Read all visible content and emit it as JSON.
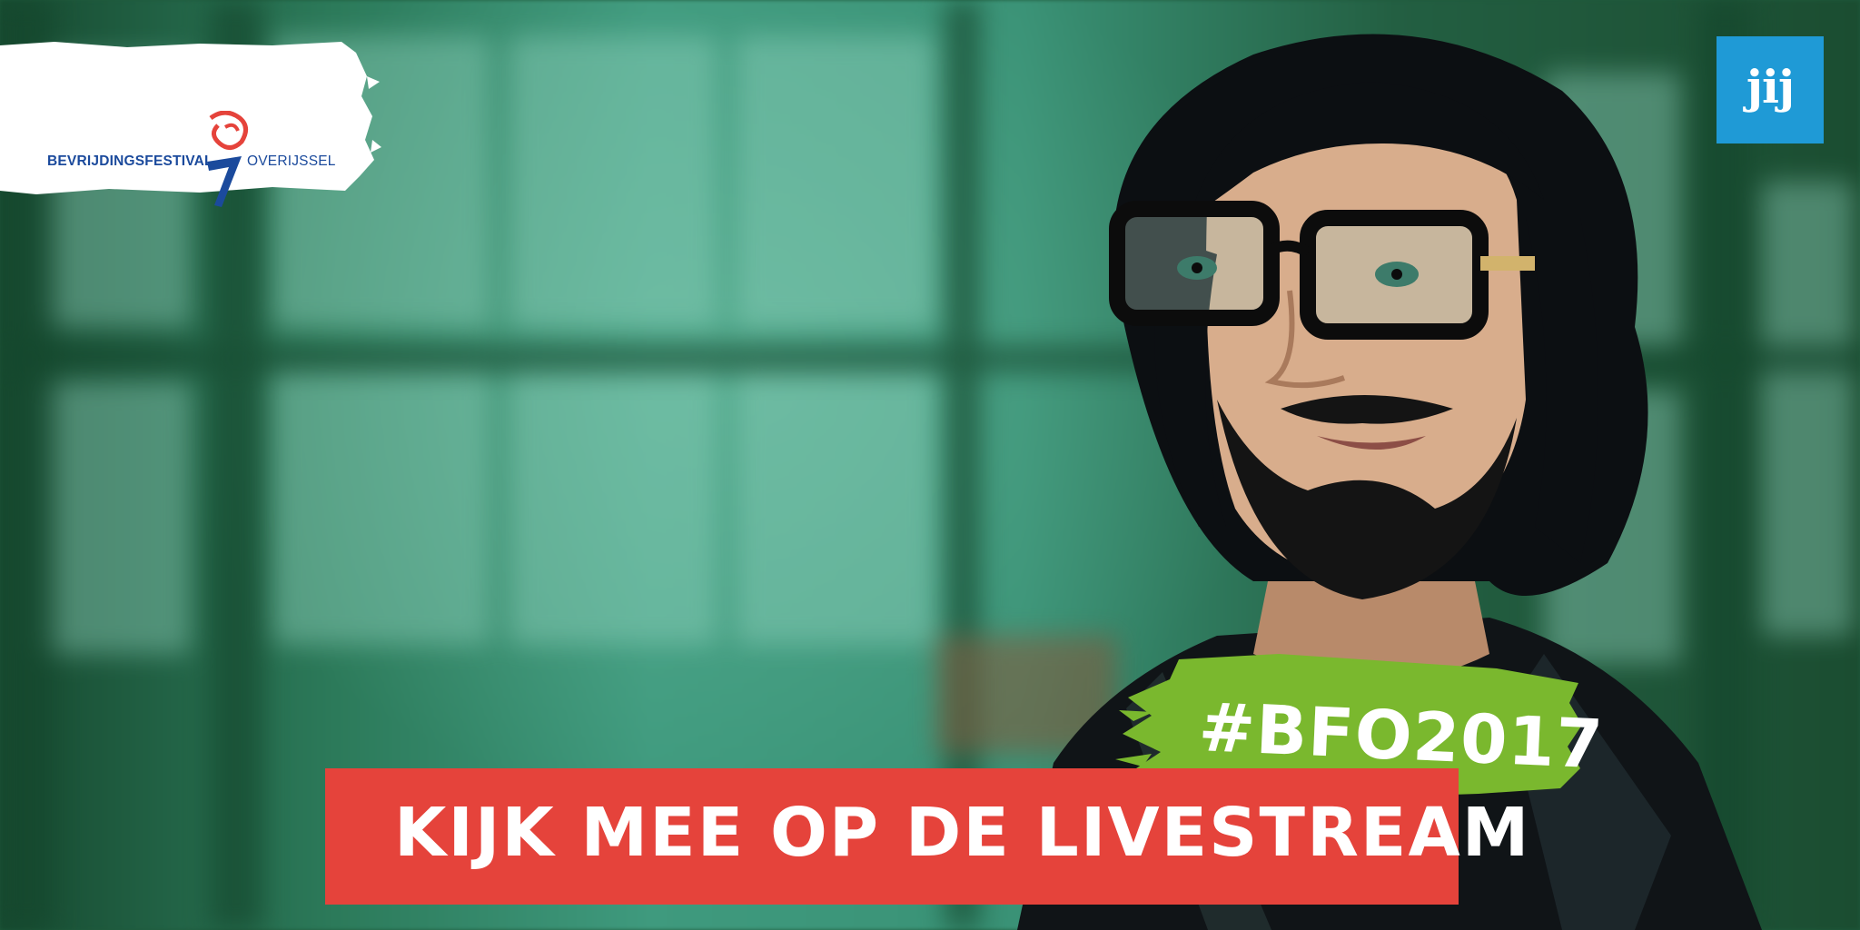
{
  "logo": {
    "left_text": "BEVRIJDINGSFESTIVAL",
    "right_text": "OVERIJSSEL",
    "brand_blue": "#1b4a9c",
    "accent_red": "#e5433b",
    "icon": "festival-torch-logo-icon"
  },
  "badge": {
    "text": "jij",
    "color": "#1f9ad6"
  },
  "hashtag": {
    "text": "#BFO2017",
    "color": "#7ab82e"
  },
  "cta": {
    "text": "KIJK MEE OP DE LIVESTREAM",
    "color": "#e5433b"
  }
}
